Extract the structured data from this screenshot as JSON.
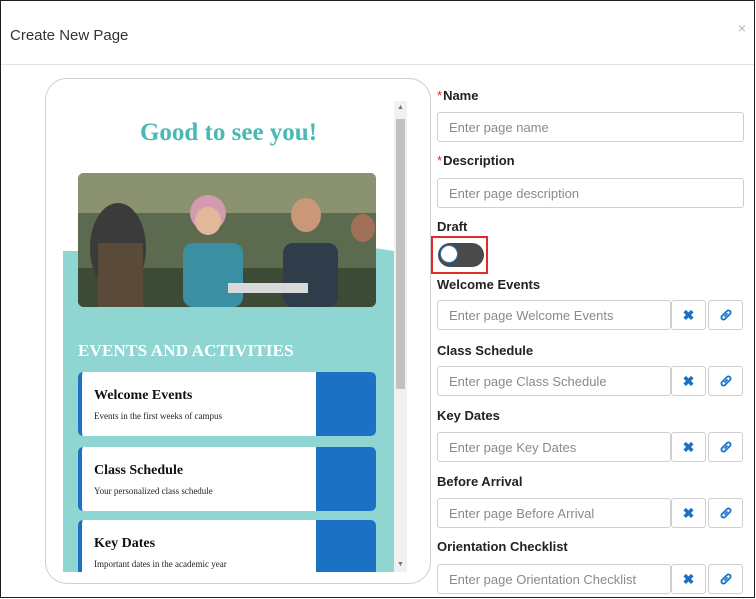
{
  "modal": {
    "title": "Create New Page",
    "close_icon": "×"
  },
  "preview": {
    "greeting": "Good to see you!",
    "section_title": "EVENTS AND ACTIVITIES",
    "cards": [
      {
        "title": "Welcome Events",
        "subtitle": "Events in the first weeks of campus"
      },
      {
        "title": "Class Schedule",
        "subtitle": "Your personalized class schedule"
      },
      {
        "title": "Key Dates",
        "subtitle": "Important dates in the academic year"
      }
    ],
    "colors": {
      "teal": "#8fd6d2",
      "greeting": "#48b9b3",
      "card_accent": "#1b72c4"
    }
  },
  "form": {
    "name": {
      "label": "Name",
      "required_mark": "*",
      "placeholder": "Enter page name",
      "value": ""
    },
    "description": {
      "label": "Description",
      "required_mark": "*",
      "placeholder": "Enter page description",
      "value": ""
    },
    "draft": {
      "label": "Draft",
      "checked": false
    },
    "welcome_events": {
      "label": "Welcome Events",
      "placeholder": "Enter page Welcome Events"
    },
    "class_schedule": {
      "label": "Class Schedule",
      "placeholder": "Enter page Class Schedule"
    },
    "key_dates": {
      "label": "Key Dates",
      "placeholder": "Enter page Key Dates"
    },
    "before_arrival": {
      "label": "Before Arrival",
      "placeholder": "Enter page Before Arrival"
    },
    "orientation_checklist": {
      "label": "Orientation Checklist",
      "placeholder": "Enter page Orientation Checklist"
    }
  }
}
